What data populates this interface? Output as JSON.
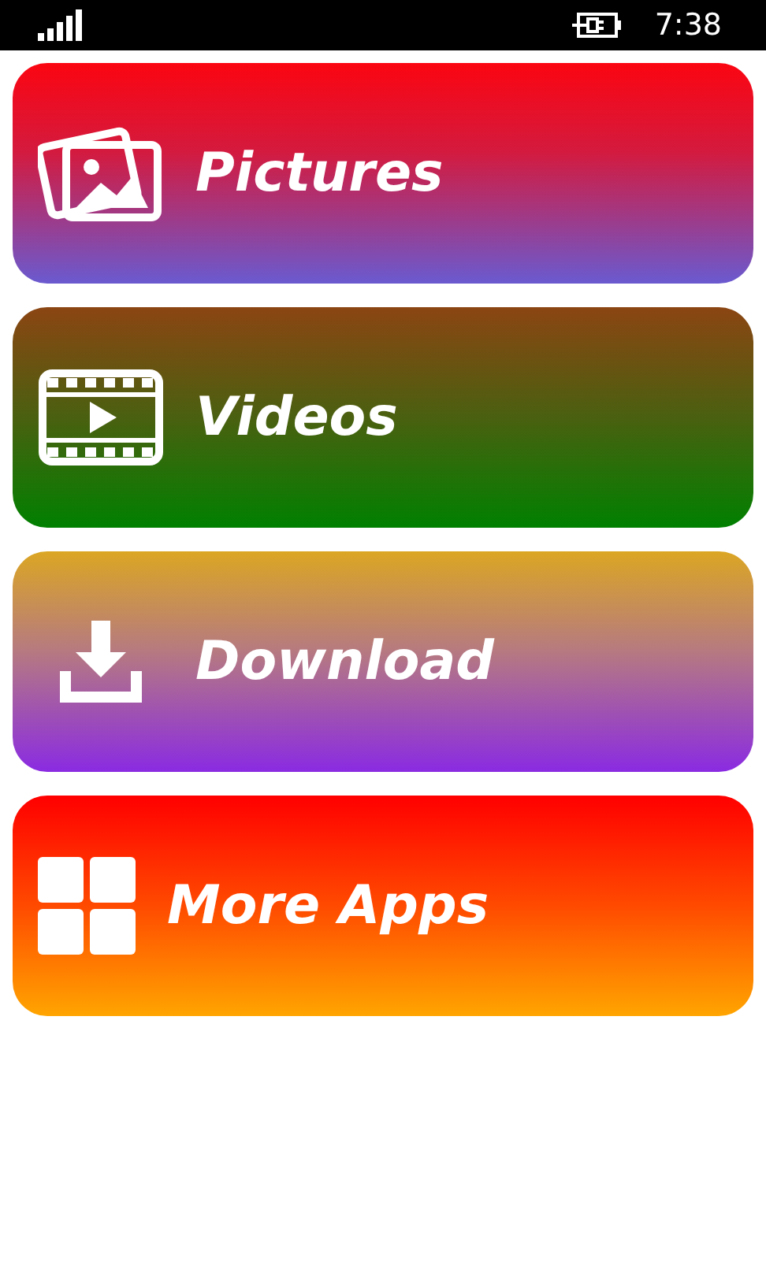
{
  "status_bar": {
    "time": "7:38"
  },
  "tiles": [
    {
      "kind": "pictures",
      "label": "Pictures"
    },
    {
      "kind": "videos",
      "label": "Videos"
    },
    {
      "kind": "download",
      "label": "Download"
    },
    {
      "kind": "apps",
      "label": "More Apps"
    }
  ]
}
